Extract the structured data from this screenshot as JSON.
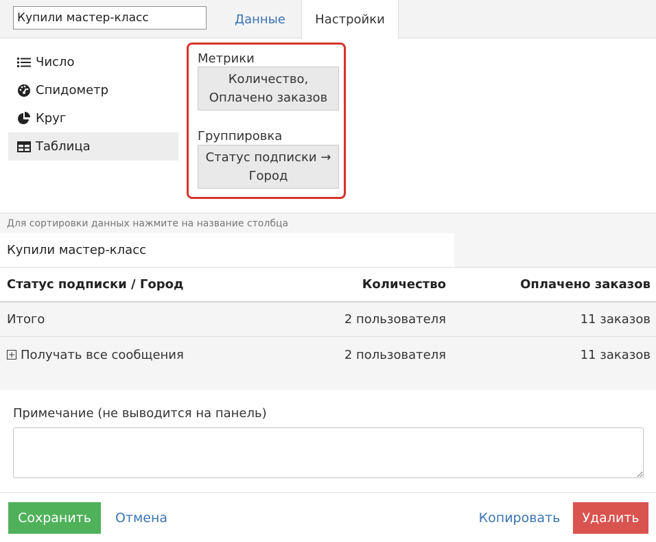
{
  "header": {
    "report_name": "Купили мастер-класс",
    "tabs": [
      {
        "label": "Данные"
      },
      {
        "label": "Настройки"
      }
    ]
  },
  "view_types": [
    {
      "label": "Число",
      "icon": "list-icon"
    },
    {
      "label": "Спидометр",
      "icon": "speedometer-icon"
    },
    {
      "label": "Круг",
      "icon": "pie-chart-icon"
    },
    {
      "label": "Таблица",
      "icon": "table-icon",
      "active": true
    }
  ],
  "settings": {
    "metrics_label": "Метрики",
    "metrics_value": "Количество, Оплачено заказов",
    "grouping_label": "Группировка",
    "grouping_value": "Статус подписки → Город",
    "highlight_color": "#d6332b"
  },
  "preview": {
    "hint": "Для сортировки данных нажмите на название столбца",
    "title": "Купили мастер-класс",
    "columns": [
      "Статус подписки / Город",
      "Количество",
      "Оплачено заказов"
    ],
    "rows": [
      {
        "label": "Итого",
        "count": "2 пользователя",
        "orders": "11 заказов"
      },
      {
        "label": "Получать все сообщения",
        "count": "2 пользователя",
        "orders": "11 заказов",
        "expandable": true
      }
    ]
  },
  "note": {
    "label": "Примечание (не выводится на панель)",
    "value": ""
  },
  "footer": {
    "save_label": "Сохранить",
    "cancel_label": "Отмена",
    "copy_label": "Копировать",
    "delete_label": "Удалить",
    "save_color": "#4fb15a",
    "delete_color": "#d9534f"
  }
}
